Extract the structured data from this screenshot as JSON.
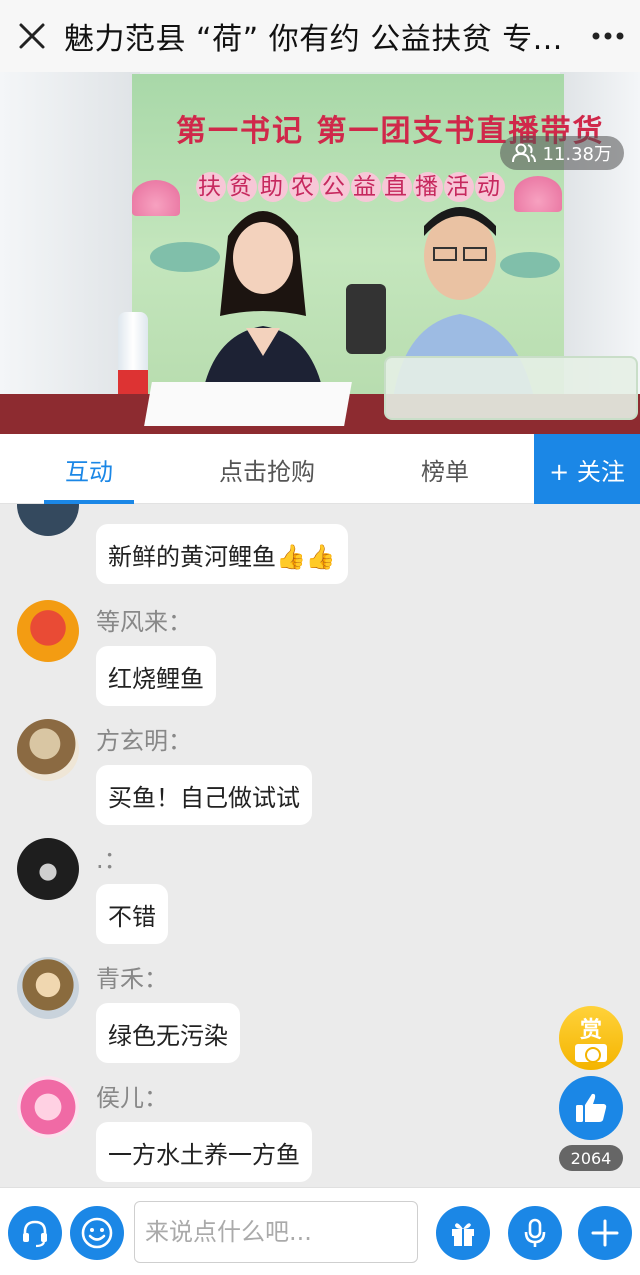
{
  "titlebar": {
    "title": "魅力范县 “荷” 你有约 公益扶贫 专...",
    "close_icon": "close-icon",
    "more_icon": "more-icon"
  },
  "video": {
    "banner_line1": "第一书记 第一团支书直播带货",
    "banner_line2": [
      "扶",
      "贫",
      "助",
      "农",
      "公",
      "益",
      "直",
      "播",
      "活",
      "动"
    ],
    "viewer_count": "11.38万",
    "viewer_icon": "people-icon"
  },
  "tabs": [
    {
      "label": "互动",
      "active": true
    },
    {
      "label": "点击抢购",
      "active": false
    },
    {
      "label": "榜单",
      "active": false
    }
  ],
  "follow_label": "+ 关注",
  "messages": [
    {
      "name": "",
      "text": "新鲜的黄河鲤鱼👍👍"
    },
    {
      "name": "等风来：",
      "text": "红烧鲤鱼"
    },
    {
      "name": "方玄明：",
      "text": "买鱼！自己做试试"
    },
    {
      "name": ".：",
      "text": "不错"
    },
    {
      "name": "青禾：",
      "text": "绿色无污染"
    },
    {
      "name": "侯儿：",
      "text": "一方水土养一方鱼"
    }
  ],
  "reward_label": "赏",
  "like_count": "2064",
  "input": {
    "placeholder": "来说点什么吧..."
  },
  "colors": {
    "accent": "#1b87e6",
    "reward": "#f4b400"
  }
}
